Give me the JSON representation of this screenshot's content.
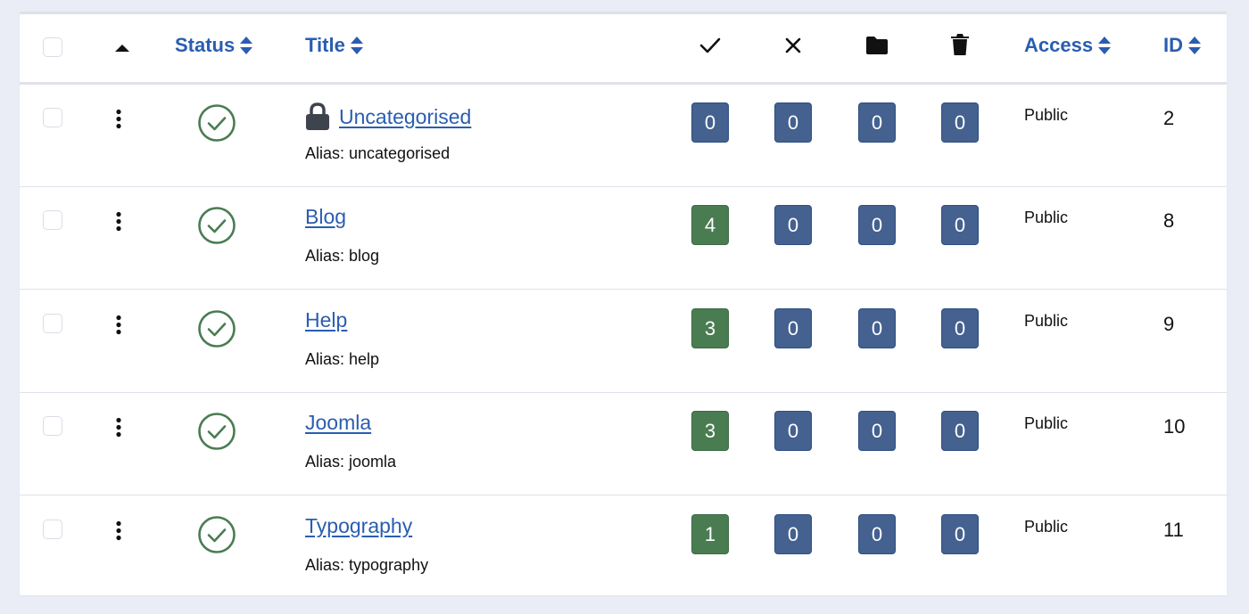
{
  "colors": {
    "link": "#2a5db0",
    "published_green": "#4a7c52",
    "badge_green": "#4a7c52",
    "badge_blue": "#44618f",
    "page_bg": "#eaedf5"
  },
  "header": {
    "select_all_label": "",
    "ordering_icon": "caret-up-icon",
    "status_label": "Status",
    "title_label": "Title",
    "published_icon": "check-icon",
    "unpublished_icon": "times-icon",
    "archived_icon": "folder-icon",
    "trashed_icon": "trash-icon",
    "access_label": "Access",
    "id_label": "ID"
  },
  "rows": [
    {
      "title": "Uncategorised",
      "alias": "Alias: uncategorised",
      "locked": true,
      "status": "published",
      "published": "0",
      "unpublished": "0",
      "archived": "0",
      "trashed": "0",
      "access": "Public",
      "id": "2"
    },
    {
      "title": "Blog",
      "alias": "Alias: blog",
      "locked": false,
      "status": "published",
      "published": "4",
      "unpublished": "0",
      "archived": "0",
      "trashed": "0",
      "access": "Public",
      "id": "8"
    },
    {
      "title": "Help",
      "alias": "Alias: help",
      "locked": false,
      "status": "published",
      "published": "3",
      "unpublished": "0",
      "archived": "0",
      "trashed": "0",
      "access": "Public",
      "id": "9"
    },
    {
      "title": "Joomla",
      "alias": "Alias: joomla",
      "locked": false,
      "status": "published",
      "published": "3",
      "unpublished": "0",
      "archived": "0",
      "trashed": "0",
      "access": "Public",
      "id": "10"
    },
    {
      "title": "Typography",
      "alias": "Alias: typography",
      "locked": false,
      "status": "published",
      "published": "1",
      "unpublished": "0",
      "archived": "0",
      "trashed": "0",
      "access": "Public",
      "id": "11"
    }
  ]
}
